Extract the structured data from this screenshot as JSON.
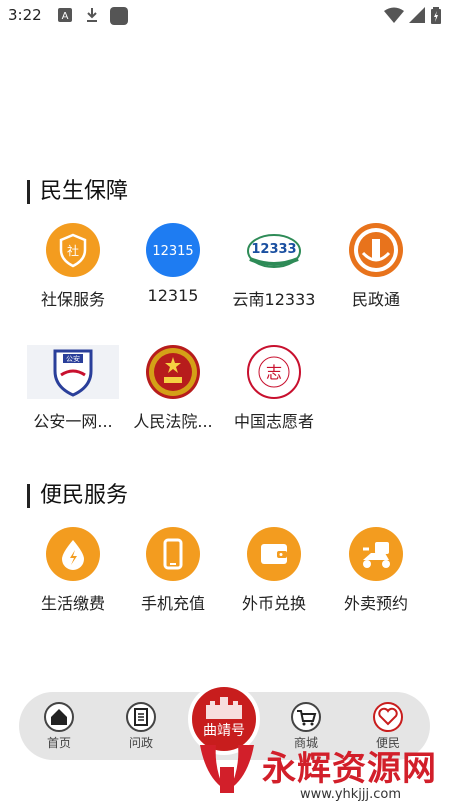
{
  "status_bar": {
    "time": "3:22"
  },
  "sections": [
    {
      "title": "民生保障",
      "items": [
        {
          "label": "社保服务",
          "icon": "shield-icon",
          "glyph": "社"
        },
        {
          "label": "12315",
          "icon": "consumer-12315-icon",
          "glyph": "12315"
        },
        {
          "label": "云南12333",
          "icon": "hrss-12333-icon",
          "glyph": "12333"
        },
        {
          "label": "民政通",
          "icon": "civil-affairs-icon",
          "glyph": ""
        },
        {
          "label": "公安一网...",
          "icon": "police-icon",
          "glyph": "公安"
        },
        {
          "label": "人民法院...",
          "icon": "court-emblem-icon",
          "glyph": ""
        },
        {
          "label": "中国志愿者",
          "icon": "volunteer-icon",
          "glyph": "志"
        }
      ]
    },
    {
      "title": "便民服务",
      "items": [
        {
          "label": "生活缴费",
          "icon": "bill-payment-icon"
        },
        {
          "label": "手机充值",
          "icon": "phone-topup-icon"
        },
        {
          "label": "外币兑换",
          "icon": "wallet-icon"
        },
        {
          "label": "外卖预约",
          "icon": "delivery-scooter-icon"
        }
      ]
    }
  ],
  "bottom_nav": {
    "items": [
      {
        "label": "首页",
        "icon": "home-icon"
      },
      {
        "label": "问政",
        "icon": "document-icon"
      },
      {
        "label": "商城",
        "icon": "cart-icon"
      },
      {
        "label": "便民",
        "icon": "heart-icon"
      }
    ],
    "center_label": "曲靖号"
  },
  "watermark": {
    "text": "永辉资源网",
    "url": "www.yhkjjj.com"
  },
  "colors": {
    "accent": "#f39c1f",
    "brand_red": "#c81d1d",
    "blue": "#1e7cf2"
  }
}
